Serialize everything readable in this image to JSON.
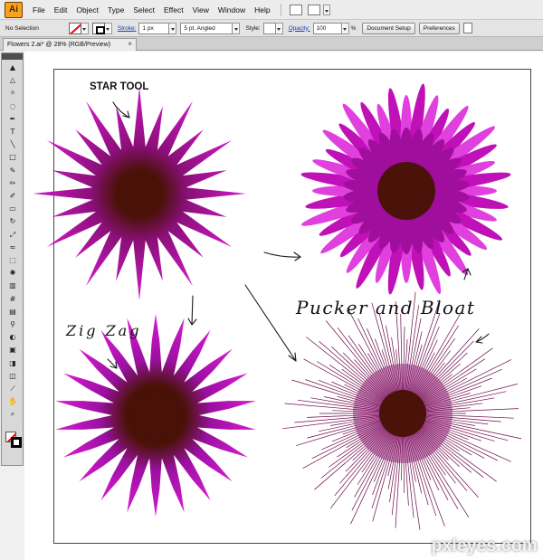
{
  "app": {
    "logo": "Ai",
    "menus": [
      "File",
      "Edit",
      "Object",
      "Type",
      "Select",
      "Effect",
      "View",
      "Window",
      "Help"
    ]
  },
  "control_bar": {
    "selection": "No Selection",
    "stroke_label": "Stroke:",
    "stroke_weight": "1 px",
    "brush": "5 pt. Angled",
    "style_label": "Style:",
    "opacity_label": "Opacity:",
    "opacity_value": "100",
    "opacity_unit": "%",
    "document_setup": "Document Setup",
    "preferences": "Preferences"
  },
  "document_tab": {
    "title": "Flowers 2.ai* @ 28% (RGB/Preview)",
    "close": "×"
  },
  "canvas": {
    "annotations": {
      "star_tool": "STAR TOOL",
      "zig_zag": "Zig Zag",
      "pucker_bloat": "Pucker and Bloat"
    },
    "colors": {
      "petal": "#c010b8",
      "petal_light": "#e040de",
      "center": "#4a1208",
      "hairline": "#6b0a4a"
    }
  },
  "watermark": "pxleyes.com"
}
